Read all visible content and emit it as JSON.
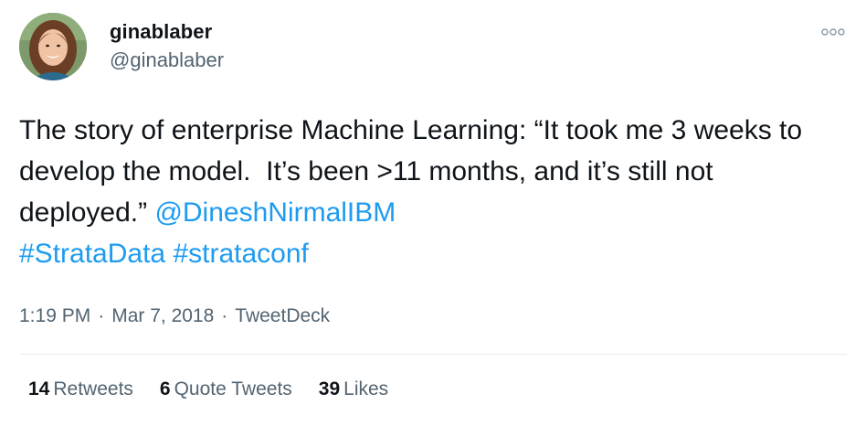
{
  "author": {
    "display_name": "ginablaber",
    "handle": "@ginablaber"
  },
  "tweet": {
    "text_parts": [
      "The story of enterprise Machine Learning: “It took me 3 weeks to develop the model.  It’s been >11 months, and it’s still not deployed.” "
    ],
    "mention": "@DineshNirmalIBM",
    "hashtag_1": "#StrataData",
    "hashtag_2": "#strataconf"
  },
  "meta": {
    "time": "1:19 PM",
    "separator": "·",
    "date": "Mar 7, 2018",
    "source": "TweetDeck"
  },
  "stats": {
    "retweets_count": "14",
    "retweets_label": "Retweets",
    "quotes_count": "6",
    "quotes_label": "Quote Tweets",
    "likes_count": "39",
    "likes_label": "Likes"
  },
  "colors": {
    "link": "#1d9bf0",
    "secondary_text": "#536471",
    "primary_text": "#0f1419"
  },
  "icons": {
    "more": "more-options-icon"
  }
}
